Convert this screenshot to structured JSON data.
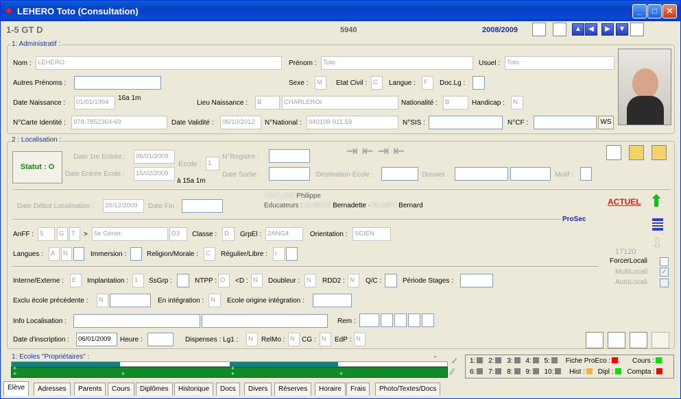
{
  "window": {
    "title": "LEHERO Toto (Consultation)"
  },
  "header": {
    "class": "1-5 GT D",
    "number": "5940",
    "year": "2008/2009"
  },
  "admin": {
    "section": "1: Administratif :",
    "nom_label": "Nom :",
    "nom": "LEHERO",
    "prenom_label": "Prénom :",
    "prenom": "Toto",
    "usuel_label": "Usuel :",
    "usuel": "Toto",
    "autres_label": "Autres Prénoms :",
    "sexe_label": "Sexe :",
    "sexe": "M",
    "etat_label": "Etat Civil :",
    "etat": "C",
    "langue_label": "Langue :",
    "langue": "F",
    "doclg_label": "Doc.Lg :",
    "naiss_label": "Date Naissance :",
    "naiss": "01/01/1994",
    "age": "16a 1m",
    "lieu_label": "Lieu Naissance :",
    "lieu_code": "B",
    "lieu": "CHARLEROI",
    "nat_label": "Nationalité :",
    "nat": "B",
    "handi_label": "Handicap :",
    "handi": "N",
    "carte_label": "N°Carte Identité :",
    "carte": "978-7852364-69",
    "valid_label": "Date Validité :",
    "valid": "06/10/2012",
    "natnum_label": "N°National :",
    "natnum": "940108-911.59",
    "sis_label": "N°SIS :",
    "cf_label": "N°CF :",
    "ws": "WS"
  },
  "loc": {
    "section": "2 : Localisation :",
    "statut": "Statut : O",
    "entree1_label": "Date 1re Entrée :",
    "entree1": "06/01/2009",
    "entree_label": "Date Entrée Ecole :",
    "entree": "15/02/2009",
    "duree": "à 15a 1m",
    "ecole_label": "Ecole :",
    "ecole": "1",
    "registre_label": "N°Registre :",
    "sortie_label": "Date Sortie :",
    "dest_label": "Destination Ecole :",
    "dossier_label": "Dossier :",
    "motif_label": "Motif :",
    "debut_label": "Date Début Localisation :",
    "debut": "20/12/2009",
    "fin_label": "Date Fin :",
    "titulaire_blur": "ONCLINX",
    "titulaire": "Philippe",
    "educ_label": "Educateurs :",
    "educ1_blur": "DUBOIS",
    "educ1": "Bernadette",
    "educ_sep": "-",
    "educ2_blur": "RUMET",
    "educ2": "Bernard",
    "actuel": "ACTUEL",
    "prosec": "ProSec",
    "anff_label": "AnFF :",
    "anff1": "5",
    "anff2": "G",
    "anff3": "T",
    "arrow": ">",
    "anff_desc": "5e Génér.",
    "anff_code": "D3",
    "classe_label": "Classe :",
    "classe": "D",
    "grpel_label": "GrpEl :",
    "grpel": "2ANG4",
    "orient_label": "Orientation :",
    "orient": "SCIEN",
    "langues_label": "Langues :",
    "lang1": "A",
    "lang2": "N",
    "immersion_label": "Immersion :",
    "religion_label": "Religion/Morale :",
    "religion": "C",
    "regulier_label": "Régulier/Libre :",
    "regulier": "r",
    "num": "17120",
    "forcer": "ForcerLocali",
    "multi": "MultiLocali",
    "auto": "AutoLocali",
    "check": "✓",
    "interne_label": "Interne/Externe :",
    "interne": "E",
    "implant_label": "Implantation :",
    "implant": "1",
    "ssgrp_label": "SsGrp :",
    "ntpp_label": "NTPP :",
    "ntpp": "O",
    "lt_label": "<D :",
    "lt": "N",
    "doubleur_label": "Doubleur :",
    "doubleur": "N",
    "rdd2_label": "RDD2 :",
    "rdd2": "N",
    "qc_label": "Q/C :",
    "periode_label": "Période Stages :",
    "exclu_label": "Exclu école précédente :",
    "exclu": "N",
    "integ_label": "En intégration :",
    "integ": "N",
    "origine_label": "Ecole origine intégration :",
    "info_label": "Info Localisation :",
    "rem_label": "Rem :",
    "inscr_label": "Date d'inscription :",
    "inscr": "06/01/2009",
    "heure_label": "Heure :",
    "disp_label": "Dispenses : Lg1 :",
    "lg1": "N",
    "relmo_label": "RelMo :",
    "relmo": "N",
    "cg_label": "CG :",
    "cg": "N",
    "edp_label": "EdP :",
    "edp": "N"
  },
  "ecoles": {
    "label": "1: Ecoles \"Propriétaires\" :",
    "dash": "-",
    "plus": "+"
  },
  "status": {
    "n1": "1:",
    "n2": "2:",
    "n3": "3:",
    "n4": "4:",
    "n5": "5:",
    "n6": "6:",
    "n7": "7:",
    "n8": "8:",
    "n9": "9:",
    "n10": "10:",
    "proeco": "Fiche ProEco :",
    "cours": "Cours :",
    "hist": "Hist :",
    "dipl": "Dipl :",
    "compta": "Compta :",
    "colors": {
      "grey": "#808080",
      "red": "#ff0000",
      "green": "#00e000",
      "orange": "#ffb040"
    }
  },
  "tabs": [
    "Elève",
    "Adresses",
    "Parents",
    "Cours",
    "Diplômes",
    "Historique",
    "Docs",
    "Divers",
    "Réserves",
    "Horaire",
    "Frais",
    "Photo/Textes/Docs"
  ]
}
